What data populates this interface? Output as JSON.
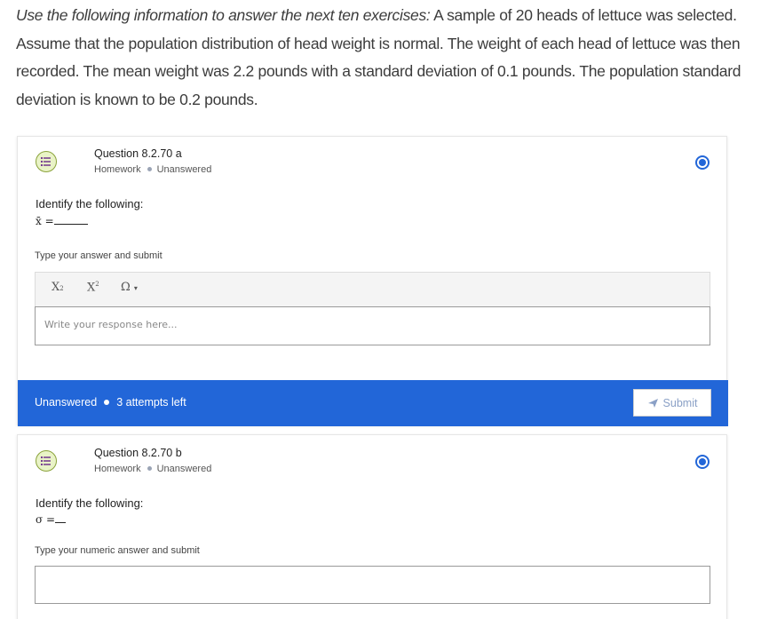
{
  "intro": {
    "lead": "Use the following information to answer the next ten exercises:",
    "body": " A sample of 20 heads of lettuce was selected. Assume that the population distribution of head weight is normal. The weight of each head of lettuce was then recorded. The mean weight was 2.2 pounds with a standard deviation of 0.1 pounds. The population standard deviation is known to be 0.2 pounds."
  },
  "questions": [
    {
      "title": "Question 8.2.70 a",
      "category": "Homework",
      "status": "Unanswered",
      "prompt": "Identify the following:",
      "symbol": "x̄ =",
      "hint": "Type your answer and submit",
      "toolbar": {
        "subscript": "X",
        "superscript": "X",
        "omega": "Ω"
      },
      "response_placeholder": "Write your response here...",
      "footer": {
        "status": "Unanswered",
        "attempts": "3 attempts left",
        "submit_label": "Submit"
      }
    },
    {
      "title": "Question 8.2.70 b",
      "category": "Homework",
      "status": "Unanswered",
      "prompt": "Identify the following:",
      "symbol": "σ =",
      "hint": "Type your numeric answer and submit"
    }
  ],
  "colors": {
    "accent": "#2266d8",
    "icon_bg": "#e9f3c7",
    "icon_border": "#8aa23a"
  },
  "icons": {
    "question": "list-icon",
    "flag": "bookmark-icon",
    "submit": "send-icon"
  }
}
